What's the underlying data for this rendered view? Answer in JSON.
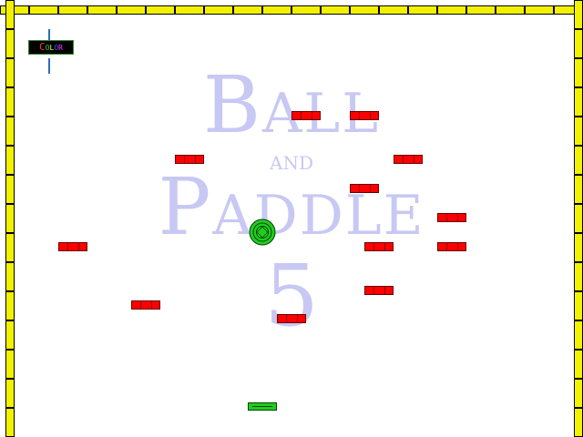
{
  "game": {
    "title_line1": "Ball",
    "title_line2": "and",
    "title_line3": "Paddle",
    "title_line4": "5"
  },
  "controls": {
    "color_toggle_letters": [
      {
        "char": "C",
        "color": "#ff3333"
      },
      {
        "char": "o",
        "color": "#33cc33"
      },
      {
        "char": "l",
        "color": "#ffff33"
      },
      {
        "char": "o",
        "color": "#3366ff"
      },
      {
        "char": "r",
        "color": "#ff33ff"
      }
    ]
  },
  "colors": {
    "wall": "#f2f200",
    "brick": "#ff0000",
    "ball": "#22cc22",
    "paddle": "#22cc22",
    "title": "#c8c8f4"
  }
}
